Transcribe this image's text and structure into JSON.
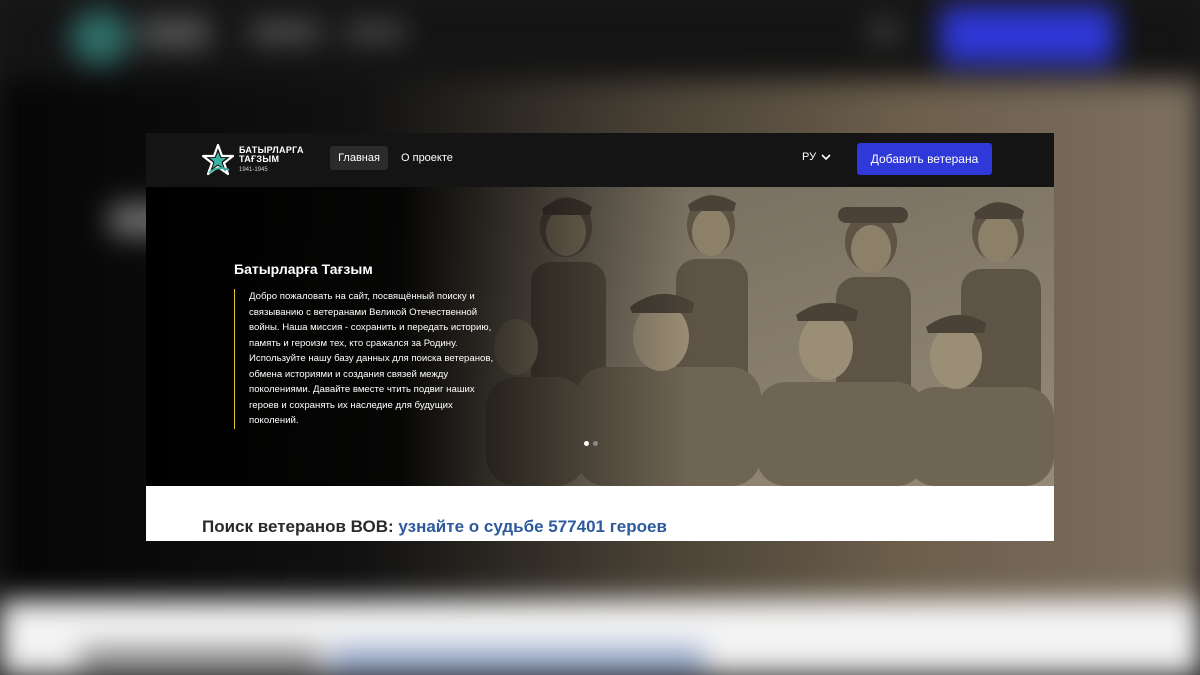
{
  "navbar": {
    "logo": {
      "line1": "БАТЫРЛАРГА",
      "line2": "ТАҒЗЫМ",
      "years": "1941-1945"
    },
    "home_label": "Главная",
    "about_label": "О проекте",
    "language": "РУ",
    "add_veteran_label": "Добавить ветерана"
  },
  "hero": {
    "title": "Батырларға Тағзым",
    "description": "Добро пожаловать на сайт, посвящённый поиску и связыванию с ветеранами Великой Отечественной войны. Наша миссия - сохранить и передать историю, память и героизм тех, кто сражался за Родину. Используйте нашу базу данных для поиска ветеранов, обмена историями и создания связей между поколениями. Давайте вместе чтить подвиг наших героев и сохранять их наследие для будущих поколений.",
    "slide_count": 2,
    "active_slide": 1
  },
  "search": {
    "heading_dark": "Поиск ветеранов ВОВ:",
    "heading_blue": "узнайте о судьбе 577401 героев"
  },
  "colors": {
    "navbar_bg": "#141414",
    "accent_blue": "#2f38d8",
    "accent_yellow": "#e3c52e",
    "heading_blue": "#2d5a9c",
    "logo_teal": "#3bb3a3"
  },
  "icons": {
    "logo": "star-emblem-icon",
    "language_dropdown": "chevron-down-icon"
  }
}
